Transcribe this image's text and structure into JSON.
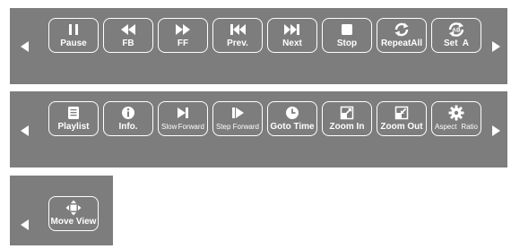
{
  "toolbar_1": {
    "buttons": [
      {
        "label": "Pause",
        "icon": "pause-icon"
      },
      {
        "label": "FB",
        "icon": "fast-backward-icon"
      },
      {
        "label": "FF",
        "icon": "fast-forward-icon"
      },
      {
        "label": "Prev.",
        "icon": "previous-track-icon"
      },
      {
        "label": "Next",
        "icon": "next-track-icon"
      },
      {
        "label": "Stop",
        "icon": "stop-icon"
      },
      {
        "label": "RepeatAll",
        "icon": "repeat-all-icon"
      },
      {
        "label": "Set  A",
        "icon": "set-ab-repeat-icon",
        "icon_text": "AB"
      }
    ]
  },
  "toolbar_2": {
    "buttons": [
      {
        "label": "Playlist",
        "icon": "playlist-icon"
      },
      {
        "label": "Info.",
        "icon": "info-icon"
      },
      {
        "label_left": "Slow",
        "label_right": "Forward",
        "icon": "slow-forward-icon"
      },
      {
        "label_left": "Step",
        "label_right": "Forward",
        "icon": "step-forward-icon"
      },
      {
        "label": "Goto Time",
        "icon": "clock-icon"
      },
      {
        "label": "Zoom In",
        "icon": "zoom-in-icon"
      },
      {
        "label": "Zoom Out",
        "icon": "zoom-out-icon"
      },
      {
        "label_left": "Aspect",
        "label_right": "Ratio",
        "icon": "gear-icon"
      }
    ]
  },
  "toolbar_3": {
    "buttons": [
      {
        "label": "Move View",
        "icon": "move-view-icon"
      }
    ]
  },
  "colors": {
    "panel": "#7d7d7d",
    "foreground": "#ffffff"
  }
}
